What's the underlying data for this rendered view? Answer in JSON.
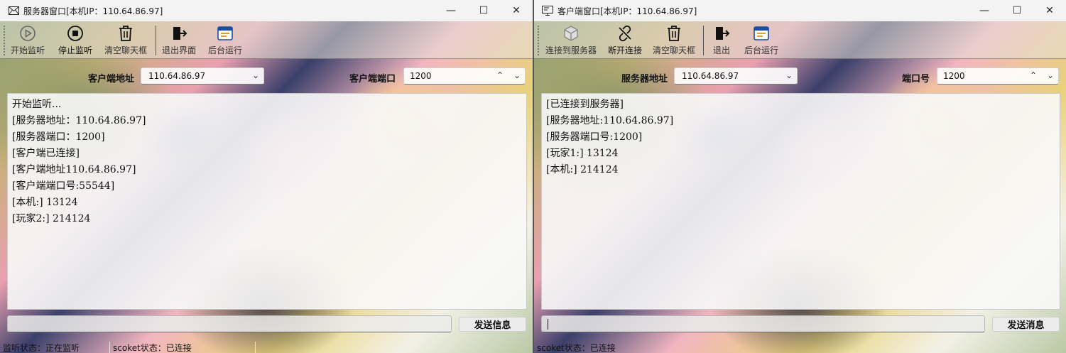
{
  "left": {
    "title": "服务器窗口[本机IP：110.64.86.97]",
    "toolbar": {
      "start": "开始监听",
      "stop": "停止监听",
      "clear": "清空聊天框",
      "exit": "退出界面",
      "background": "后台运行"
    },
    "address_label": "客户端地址",
    "address_value": "110.64.86.97",
    "port_label": "客户端端口",
    "port_value": "1200",
    "log": [
      "开始监听...",
      "[服务器地址：110.64.86.97]",
      "[服务器端口：1200]",
      "[客户端已连接]",
      "[客户端地址110.64.86.97]",
      "[客户端端口号:55544]",
      "[本机:] 13124",
      "[玩家2:] 214124"
    ],
    "send_label": "发送信息",
    "status_listen": "监听状态：正在监听",
    "status_socket": "scoket状态：已连接"
  },
  "right": {
    "title": "客户端窗口[本机IP：110.64.86.97]",
    "toolbar": {
      "connect": "连接到服务器",
      "disconnect": "断开连接",
      "clear": "清空聊天框",
      "exit": "退出",
      "background": "后台运行"
    },
    "address_label": "服务器地址",
    "address_value": "110.64.86.97",
    "port_label": "端口号",
    "port_value": "1200",
    "log": [
      "[已连接到服务器]",
      "[服务器地址:110.64.86.97]",
      "[服务器端口号:1200]",
      "[玩家1:] 13124",
      "[本机:] 214124"
    ],
    "send_label": "发送消息",
    "status_socket": "scoket状态：已连接"
  },
  "icons": {
    "left_window": "mail-icon",
    "right_window": "monitor-icon"
  }
}
